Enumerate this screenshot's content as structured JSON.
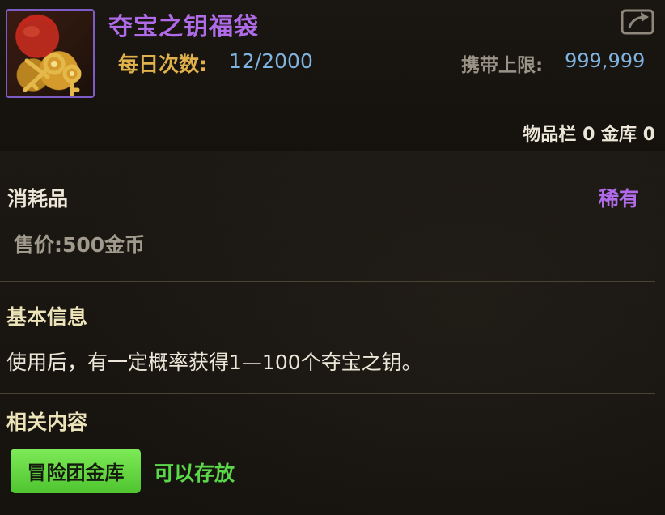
{
  "item": {
    "name": "夺宝之钥福袋",
    "icon": "treasure-bag-with-keys-icon",
    "daily_label": "每日次数:",
    "daily_value": "12/2000",
    "carry_label": "携带上限:",
    "carry_value": "999,999",
    "stock_text": "物品栏 0 金库 0"
  },
  "header": {
    "share_icon": "share-icon"
  },
  "details": {
    "category": "消耗品",
    "rarity": "稀有",
    "price": "售价:500金币"
  },
  "basic_info": {
    "title": "基本信息",
    "description": "使用后，有一定概率获得1—100个夺宝之钥。"
  },
  "related": {
    "title": "相关内容",
    "tag": "冒险团金库",
    "note": "可以存放"
  },
  "colors": {
    "title_purple": "#b06be8",
    "label_gold": "#e1b24c",
    "value_blue": "#7fb3e0",
    "tag_green": "#5bd84a",
    "background": "#1b1712"
  }
}
